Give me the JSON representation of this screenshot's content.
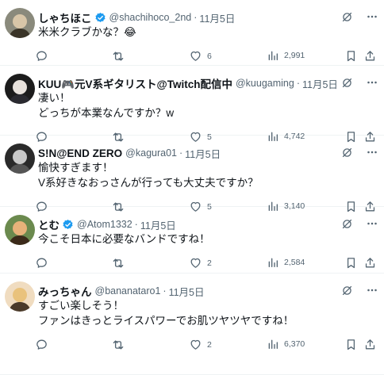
{
  "replies": [
    {
      "name": "しゃちほこ",
      "verified": true,
      "handle": "@shachihoco_2nd",
      "date": "11月5日",
      "text": "米米クラブかな？😂",
      "replies_count": "",
      "retweets": "",
      "likes": "6",
      "views": "2,991"
    },
    {
      "name": "KUU🎮元V系ギタリスト@Twitch配信中",
      "verified": false,
      "handle": "@kuugaming",
      "date": "11月5日",
      "text": "凄い！\nどっちが本業なんですか？w",
      "replies_count": "",
      "retweets": "",
      "likes": "5",
      "views": "4,742"
    },
    {
      "name": "S!N@END ZERO",
      "verified": false,
      "handle": "@kagura01",
      "date": "11月5日",
      "text": "愉快すぎます！\nV系好きなおっさんが行っても大丈夫ですか？",
      "replies_count": "",
      "retweets": "",
      "likes": "5",
      "views": "3,140"
    },
    {
      "name": "とむ",
      "verified": true,
      "handle": "@Atom1332",
      "date": "11月5日",
      "text": "今こそ日本に必要なバンドですね！",
      "replies_count": "",
      "retweets": "",
      "likes": "2",
      "views": "2,584"
    },
    {
      "name": "みっちゃん",
      "verified": false,
      "handle": "@bananataro1",
      "date": "11月5日",
      "text": "すごい楽しそう！\nファンはきっとライスパワーでお肌ツヤツヤですね！",
      "replies_count": "",
      "retweets": "",
      "likes": "2",
      "views": "6,370"
    }
  ],
  "dot_separator": "·",
  "colors": {
    "verified": "#1d9bf0",
    "muted": "#536471",
    "text": "#0f1419",
    "border": "#eff3f4"
  },
  "icons": [
    "grok-icon",
    "more-icon",
    "reply-icon",
    "retweet-icon",
    "like-icon",
    "views-icon",
    "bookmark-icon",
    "share-icon"
  ]
}
